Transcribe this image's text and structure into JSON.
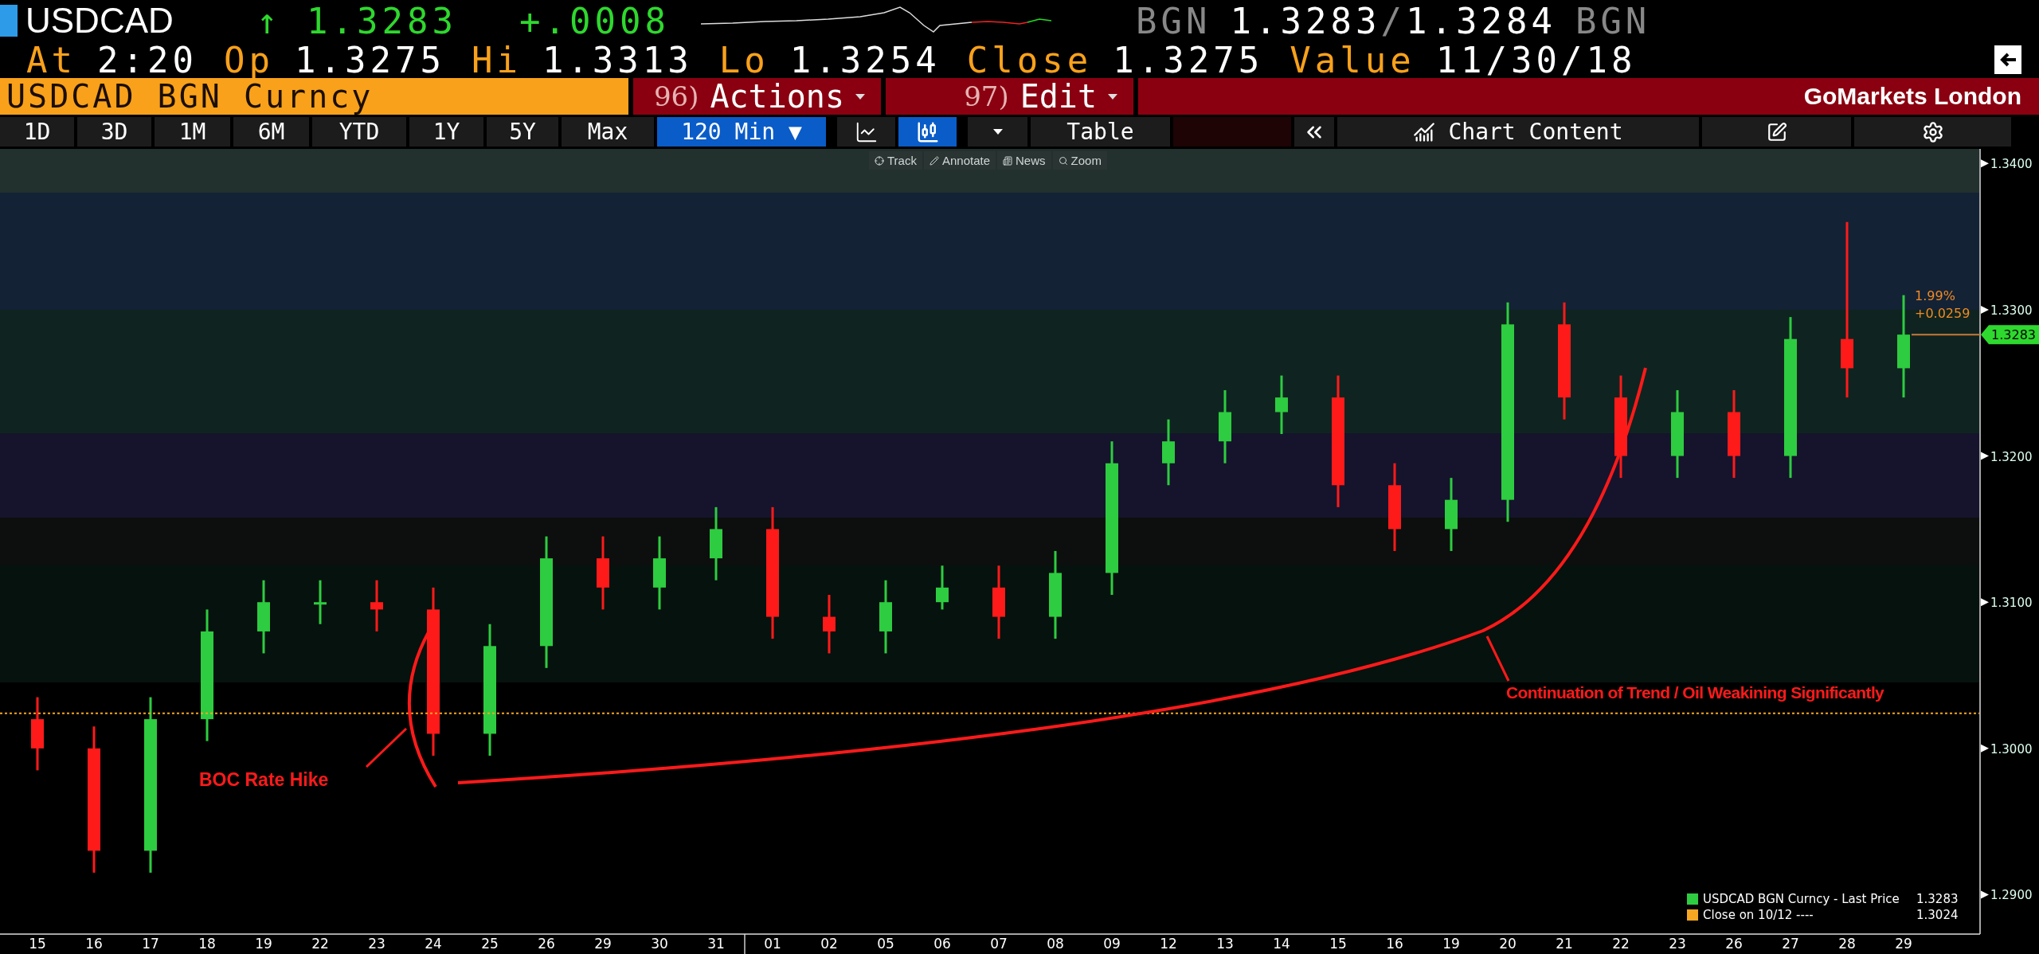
{
  "quote": {
    "ticker": "USDCAD",
    "arrow": "↑",
    "up": true,
    "last": "1.3283",
    "change": "+.0008",
    "bid_source": "BGN",
    "bid": "1.3283",
    "separator": "/",
    "ask": "1.3284",
    "ask_source": "BGN"
  },
  "stats": [
    {
      "label": "At",
      "value": "2:20"
    },
    {
      "label": "Op",
      "value": "1.3275"
    },
    {
      "label": "Hi",
      "value": "1.3313"
    },
    {
      "label": "Lo",
      "value": "1.3254"
    },
    {
      "label": "Close",
      "value": "1.3275"
    },
    {
      "label": "Value",
      "value": "11/30/18"
    }
  ],
  "command_bar": {
    "security": "USDCAD BGN Curncy",
    "menus": [
      {
        "number": "96)",
        "label": "Actions"
      },
      {
        "number": "97)",
        "label": "Edit"
      }
    ],
    "brand": "GoMarkets London"
  },
  "toolbar": {
    "ranges": [
      "1D",
      "3D",
      "1M",
      "6M",
      "YTD",
      "1Y",
      "5Y",
      "Max"
    ],
    "interval": "120 Min ▼",
    "chart_styles": [
      {
        "kind": "line",
        "selected": false
      },
      {
        "kind": "candle",
        "selected": true
      }
    ],
    "table": "Table",
    "chart_content": "Chart Content"
  },
  "chart_tools": [
    {
      "kind": "track",
      "label": "Track"
    },
    {
      "kind": "annotate",
      "label": "Annotate"
    },
    {
      "kind": "news",
      "label": "News"
    },
    {
      "kind": "zoom",
      "label": "Zoom"
    }
  ],
  "chart": {
    "chart_data": {
      "type": "candlestick",
      "categories": [
        "15",
        "16",
        "17",
        "18",
        "19",
        "22",
        "23",
        "24",
        "25",
        "26",
        "29",
        "30",
        "31",
        "01",
        "02",
        "05",
        "06",
        "07",
        "08",
        "09",
        "12",
        "13",
        "14",
        "15",
        "16",
        "19",
        "20",
        "21",
        "22",
        "23",
        "26",
        "27",
        "28",
        "29"
      ],
      "ohlc": [
        [
          1.302,
          1.3035,
          1.2985,
          1.3
        ],
        [
          1.3,
          1.3015,
          1.2915,
          1.293
        ],
        [
          1.293,
          1.3035,
          1.2915,
          1.302
        ],
        [
          1.302,
          1.3095,
          1.3005,
          1.308
        ],
        [
          1.308,
          1.3115,
          1.3065,
          1.31
        ],
        [
          1.31,
          1.3115,
          1.3085,
          1.31
        ],
        [
          1.31,
          1.3115,
          1.308,
          1.3095
        ],
        [
          1.3095,
          1.311,
          1.2995,
          1.301
        ],
        [
          1.301,
          1.3085,
          1.2995,
          1.307
        ],
        [
          1.307,
          1.3145,
          1.3055,
          1.313
        ],
        [
          1.313,
          1.3145,
          1.3095,
          1.311
        ],
        [
          1.311,
          1.3145,
          1.3095,
          1.313
        ],
        [
          1.313,
          1.3165,
          1.3115,
          1.315
        ],
        [
          1.315,
          1.3165,
          1.3075,
          1.309
        ],
        [
          1.309,
          1.3105,
          1.3065,
          1.308
        ],
        [
          1.308,
          1.3115,
          1.3065,
          1.31
        ],
        [
          1.31,
          1.3125,
          1.3095,
          1.311
        ],
        [
          1.311,
          1.3125,
          1.3075,
          1.309
        ],
        [
          1.309,
          1.3135,
          1.3075,
          1.312
        ],
        [
          1.312,
          1.321,
          1.3105,
          1.3195
        ],
        [
          1.3195,
          1.3225,
          1.318,
          1.321
        ],
        [
          1.321,
          1.3245,
          1.3195,
          1.323
        ],
        [
          1.323,
          1.3255,
          1.3215,
          1.324
        ],
        [
          1.324,
          1.3255,
          1.3165,
          1.318
        ],
        [
          1.318,
          1.3195,
          1.3135,
          1.315
        ],
        [
          1.315,
          1.3185,
          1.3135,
          1.317
        ],
        [
          1.317,
          1.3305,
          1.3155,
          1.329
        ],
        [
          1.329,
          1.3305,
          1.3225,
          1.324
        ],
        [
          1.324,
          1.3255,
          1.3185,
          1.32
        ],
        [
          1.32,
          1.3245,
          1.3185,
          1.323
        ],
        [
          1.323,
          1.3245,
          1.3185,
          1.32
        ],
        [
          1.32,
          1.3295,
          1.3185,
          1.328
        ],
        [
          1.328,
          1.336,
          1.324,
          1.326
        ],
        [
          1.326,
          1.331,
          1.324,
          1.3283
        ]
      ],
      "ylim": [
        1.2873,
        1.341
      ],
      "yticks": [
        {
          "value": 1.29,
          "label": "1.2900"
        },
        {
          "value": 1.3,
          "label": "1.3000"
        },
        {
          "value": 1.31,
          "label": "1.3100"
        },
        {
          "value": 1.32,
          "label": "1.3200"
        },
        {
          "value": 1.33,
          "label": "1.3300"
        },
        {
          "value": 1.34,
          "label": "1.3400"
        }
      ],
      "annotations": [
        {
          "text": "BOC Rate Hike"
        },
        {
          "text": "Continuation of Trend / Oil Weakining Significantly"
        }
      ]
    },
    "change_pct": "1.99%",
    "change_abs": "+0.0259",
    "price_tag": "1.3283",
    "legend": [
      {
        "label": "USDCAD BGN Curncy - Last Price",
        "value": "1.3283",
        "color": "#2ecc40"
      },
      {
        "label": "Close on 10/12 ----",
        "value": "1.3024",
        "color": "#f5a623"
      }
    ]
  }
}
